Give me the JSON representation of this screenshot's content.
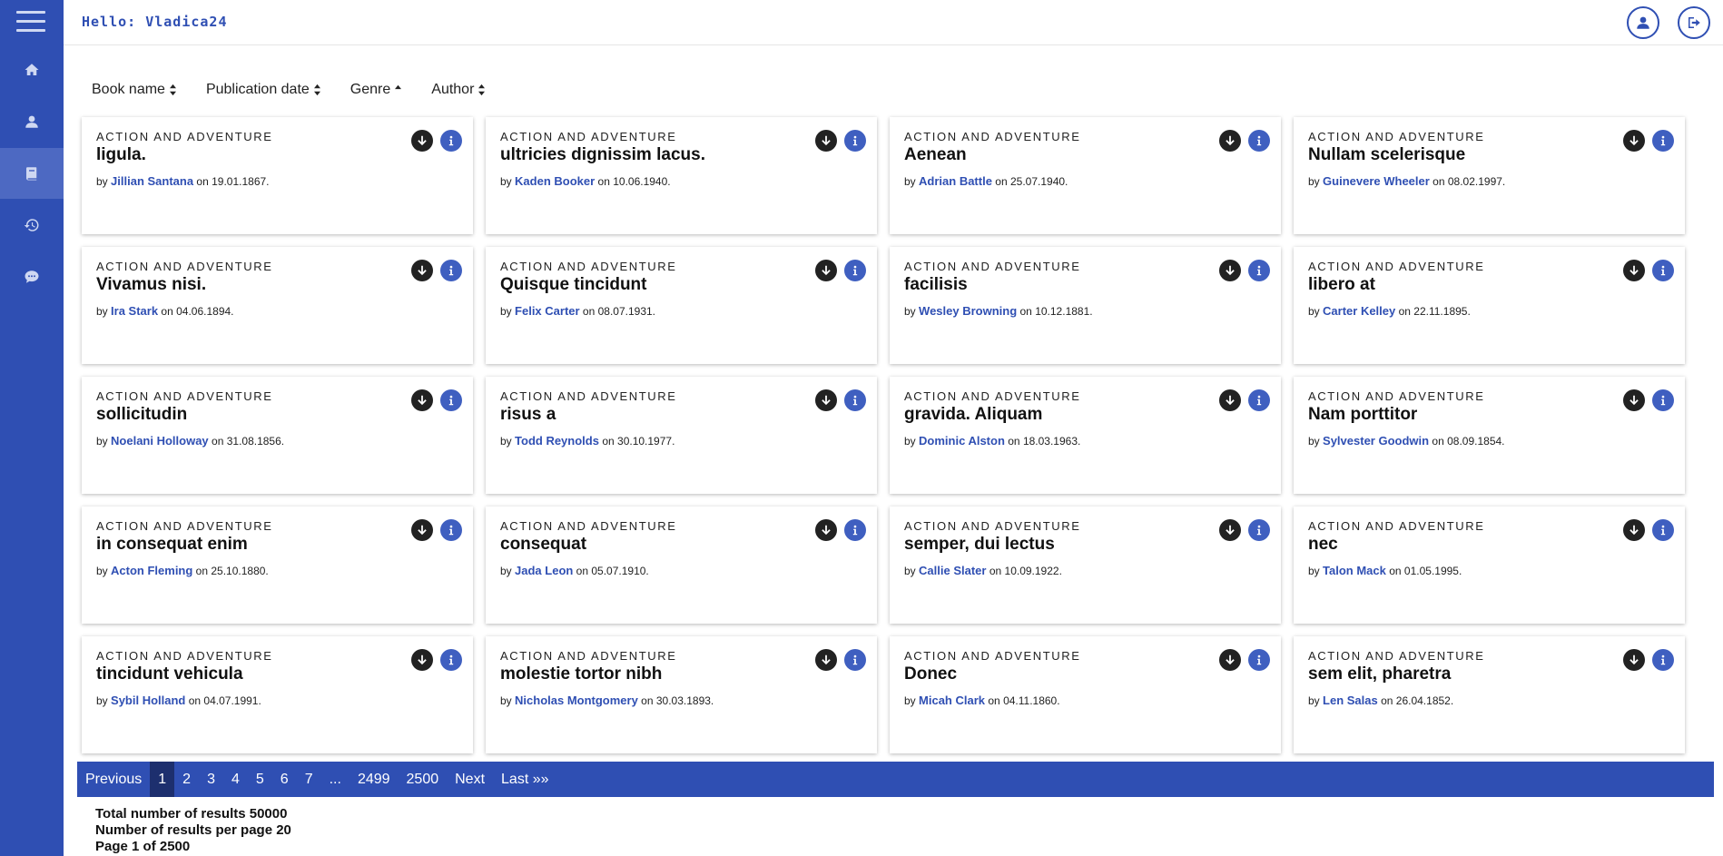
{
  "header": {
    "greeting": "Hello: Vladica24"
  },
  "sidebar": {
    "items": [
      {
        "name": "home-icon",
        "active": false
      },
      {
        "name": "user-icon",
        "active": false
      },
      {
        "name": "book-icon",
        "active": true
      },
      {
        "name": "history-icon",
        "active": false
      },
      {
        "name": "chat-icon",
        "active": false
      }
    ]
  },
  "sort": {
    "book_name": "Book name",
    "publication_date": "Publication date",
    "genre": "Genre",
    "author": "Author"
  },
  "books": [
    {
      "genre": "ACTION AND ADVENTURE",
      "title": "ligula.",
      "by": "by",
      "author": "Jillian Santana",
      "on": "on",
      "date": "19.01.1867."
    },
    {
      "genre": "ACTION AND ADVENTURE",
      "title": "ultricies dignissim lacus.",
      "by": "by",
      "author": "Kaden Booker",
      "on": "on",
      "date": "10.06.1940."
    },
    {
      "genre": "ACTION AND ADVENTURE",
      "title": "Aenean",
      "by": "by",
      "author": "Adrian Battle",
      "on": "on",
      "date": "25.07.1940."
    },
    {
      "genre": "ACTION AND ADVENTURE",
      "title": "Nullam scelerisque",
      "by": "by",
      "author": "Guinevere Wheeler",
      "on": "on",
      "date": "08.02.1997."
    },
    {
      "genre": "ACTION AND ADVENTURE",
      "title": "Vivamus nisi.",
      "by": "by",
      "author": "Ira Stark",
      "on": "on",
      "date": "04.06.1894."
    },
    {
      "genre": "ACTION AND ADVENTURE",
      "title": "Quisque tincidunt",
      "by": "by",
      "author": "Felix Carter",
      "on": "on",
      "date": "08.07.1931."
    },
    {
      "genre": "ACTION AND ADVENTURE",
      "title": "facilisis",
      "by": "by",
      "author": "Wesley Browning",
      "on": "on",
      "date": "10.12.1881."
    },
    {
      "genre": "ACTION AND ADVENTURE",
      "title": "libero at",
      "by": "by",
      "author": "Carter Kelley",
      "on": "on",
      "date": "22.11.1895."
    },
    {
      "genre": "ACTION AND ADVENTURE",
      "title": "sollicitudin",
      "by": "by",
      "author": "Noelani Holloway",
      "on": "on",
      "date": "31.08.1856."
    },
    {
      "genre": "ACTION AND ADVENTURE",
      "title": "risus a",
      "by": "by",
      "author": "Todd Reynolds",
      "on": "on",
      "date": "30.10.1977."
    },
    {
      "genre": "ACTION AND ADVENTURE",
      "title": "gravida. Aliquam",
      "by": "by",
      "author": "Dominic Alston",
      "on": "on",
      "date": "18.03.1963."
    },
    {
      "genre": "ACTION AND ADVENTURE",
      "title": "Nam porttitor",
      "by": "by",
      "author": "Sylvester Goodwin",
      "on": "on",
      "date": "08.09.1854."
    },
    {
      "genre": "ACTION AND ADVENTURE",
      "title": "in consequat enim",
      "by": "by",
      "author": "Acton Fleming",
      "on": "on",
      "date": "25.10.1880."
    },
    {
      "genre": "ACTION AND ADVENTURE",
      "title": "consequat",
      "by": "by",
      "author": "Jada Leon",
      "on": "on",
      "date": "05.07.1910."
    },
    {
      "genre": "ACTION AND ADVENTURE",
      "title": "semper, dui lectus",
      "by": "by",
      "author": "Callie Slater",
      "on": "on",
      "date": "10.09.1922."
    },
    {
      "genre": "ACTION AND ADVENTURE",
      "title": "nec",
      "by": "by",
      "author": "Talon Mack",
      "on": "on",
      "date": "01.05.1995."
    },
    {
      "genre": "ACTION AND ADVENTURE",
      "title": "tincidunt vehicula",
      "by": "by",
      "author": "Sybil Holland",
      "on": "on",
      "date": "04.07.1991."
    },
    {
      "genre": "ACTION AND ADVENTURE",
      "title": "molestie tortor nibh",
      "by": "by",
      "author": "Nicholas Montgomery",
      "on": "on",
      "date": "30.03.1893."
    },
    {
      "genre": "ACTION AND ADVENTURE",
      "title": "Donec",
      "by": "by",
      "author": "Micah Clark",
      "on": "on",
      "date": "04.11.1860."
    },
    {
      "genre": "ACTION AND ADVENTURE",
      "title": "sem elit, pharetra",
      "by": "by",
      "author": "Len Salas",
      "on": "on",
      "date": "26.04.1852."
    }
  ],
  "pagination": {
    "previous": "Previous",
    "pages": [
      "1",
      "2",
      "3",
      "4",
      "5",
      "6",
      "7"
    ],
    "current": "1",
    "ellipsis": "...",
    "tail_pages": [
      "2499",
      "2500"
    ],
    "next": "Next",
    "last": "Last »»"
  },
  "summary": {
    "total": "Total number of results 50000",
    "per_page": "Number of results per page 20",
    "page_of": "Page 1 of 2500"
  },
  "colors": {
    "primary": "#2f4fb3",
    "active_page": "#1d2f6e",
    "info": "#3f5fc0"
  }
}
